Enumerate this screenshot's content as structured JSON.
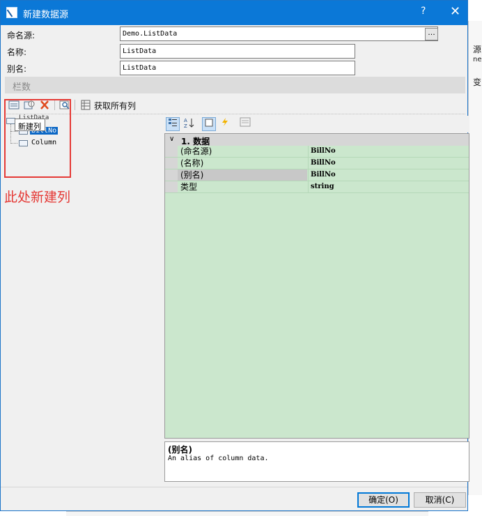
{
  "background": {
    "right_text_1": "源",
    "right_text_2": "ne",
    "right_text_3": "变"
  },
  "window": {
    "title": "新建数据源",
    "help_label": "?",
    "close_label": "✕"
  },
  "form": {
    "source_label": "命名源:",
    "source_value": "Demo.ListData",
    "source_browse": "...",
    "name_label": "名称:",
    "name_value": "ListData",
    "alias_label": "别名:",
    "alias_value": "ListData"
  },
  "section": {
    "title": "栏数"
  },
  "toolbar": {
    "icons": [
      "new-column-icon",
      "edit-column-icon",
      "delete-icon",
      "preview-icon",
      "columns-icon"
    ],
    "get_all_columns": "获取所有列"
  },
  "tree": {
    "root_label": "ListData",
    "items": [
      "BillNo",
      "Column"
    ],
    "selected_index": 0,
    "tooltip": "新建列"
  },
  "annotation": {
    "text": "此处新建列",
    "color": "#e53935"
  },
  "property_grid": {
    "category": "1. 数据",
    "rows": [
      {
        "name": "(命名源)",
        "value": "BillNo"
      },
      {
        "name": "(名称)",
        "value": "BillNo"
      },
      {
        "name": "(别名)",
        "value": "BillNo"
      },
      {
        "name": "类型",
        "value": "string"
      }
    ],
    "selected_row": 2,
    "grid_color": "#cbe7cd"
  },
  "description": {
    "title": "(别名)",
    "text": "An alias of column data."
  },
  "buttons": {
    "ok": "确定(O)",
    "cancel": "取消(C)"
  },
  "colors": {
    "titlebar": "#0b78d7",
    "accent": "#0078d7",
    "selection": "#0b67c5"
  }
}
